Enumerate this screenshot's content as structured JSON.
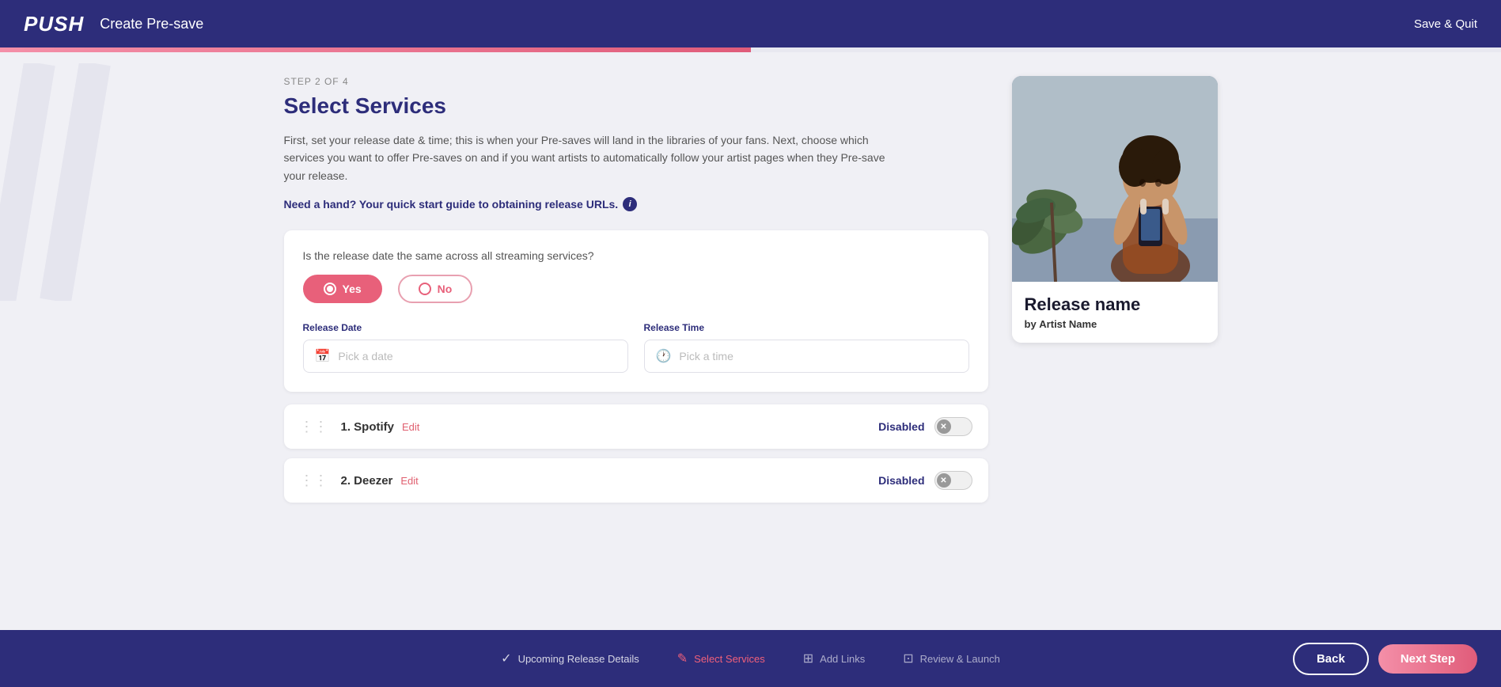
{
  "header": {
    "logo": "PUSH",
    "title": "Create Pre-save",
    "save_quit": "Save & Quit"
  },
  "progress": {
    "percent": 50,
    "step_label": "STEP 2 OF 4"
  },
  "page": {
    "title": "Select Services",
    "description": "First, set your release date & time; this is when your Pre-saves will land in the libraries of your fans. Next, choose which services you want to offer Pre-saves on and if you want artists to automatically follow your artist pages when they Pre-save your release.",
    "guide_link": "Need a hand? Your quick start guide to obtaining release URLs.",
    "radio_question": "Is the release date the same across all streaming services?",
    "radio_yes": "Yes",
    "radio_no": "No",
    "release_date_label": "Release Date",
    "release_date_placeholder": "Pick a date",
    "release_time_label": "Release Time",
    "release_time_placeholder": "Pick a time"
  },
  "services": [
    {
      "number": "1.",
      "name": "Spotify",
      "edit": "Edit",
      "status": "Disabled"
    },
    {
      "number": "2.",
      "name": "Deezer",
      "edit": "Edit",
      "status": "Disabled"
    }
  ],
  "release_card": {
    "name": "Release name",
    "by_label": "by",
    "artist": "Artist Name"
  },
  "footer": {
    "steps": [
      {
        "id": "upcoming",
        "icon": "✓",
        "label": "Upcoming Release Details",
        "state": "completed"
      },
      {
        "id": "services",
        "icon": "✎",
        "label": "Select Services",
        "state": "active"
      },
      {
        "id": "links",
        "icon": "⊞",
        "label": "Add Links",
        "state": "inactive"
      },
      {
        "id": "review",
        "icon": "⊡",
        "label": "Review & Launch",
        "state": "inactive"
      }
    ],
    "back_label": "Back",
    "next_label": "Next Step"
  }
}
